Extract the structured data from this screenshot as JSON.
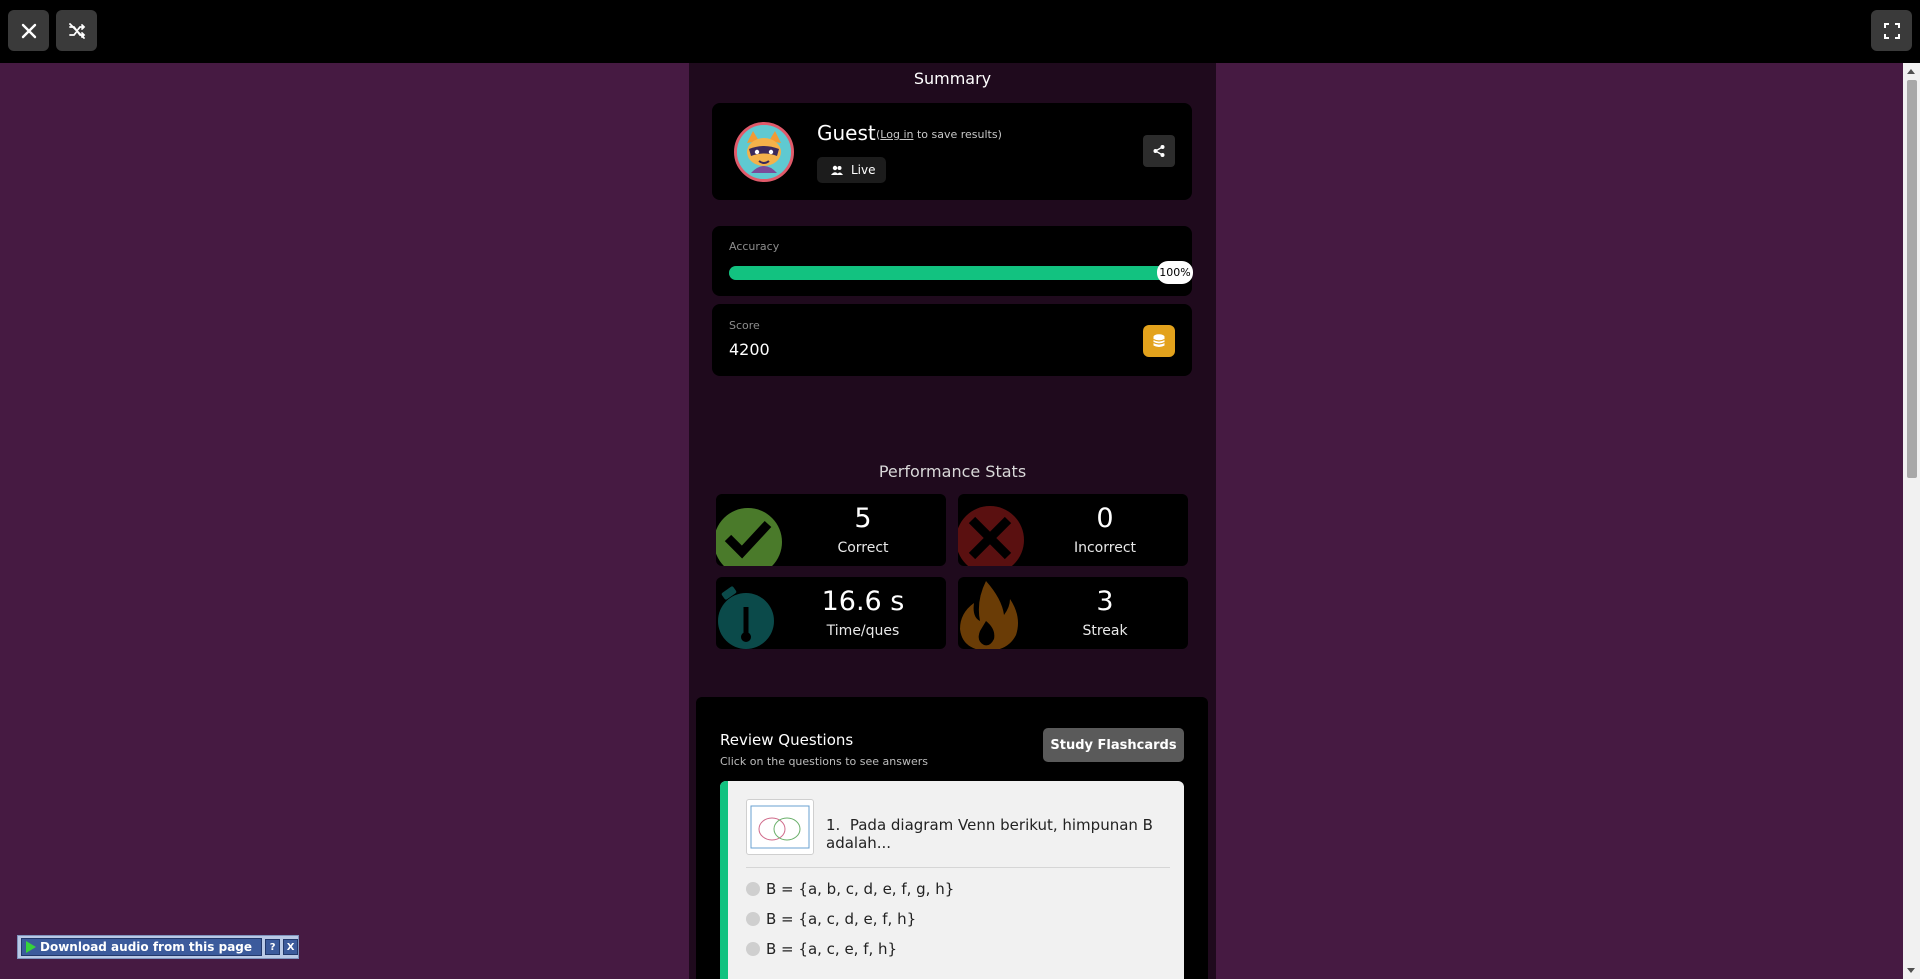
{
  "topbar": {
    "close_icon": "close-icon",
    "shuffle_off_icon": "shuffle-off-icon",
    "fullscreen_icon": "fullscreen-icon"
  },
  "summary": {
    "title": "Summary",
    "player_name": "Guest",
    "login_prefix": "(",
    "login_link": "Log in",
    "login_suffix": " to save results)",
    "mode": "Live"
  },
  "accuracy": {
    "label": "Accuracy",
    "value_text": "100%",
    "fraction": 1.0,
    "color": "#12c280"
  },
  "score": {
    "label": "Score",
    "value": "4200"
  },
  "performance": {
    "title": "Performance Stats",
    "stats": [
      {
        "value": "5",
        "label": "Correct",
        "icon": "check-icon",
        "color": "#4a7a2a"
      },
      {
        "value": "0",
        "label": "Incorrect",
        "icon": "cross-icon",
        "color": "#5a1010"
      },
      {
        "value": "16.6 s",
        "label": "Time/ques",
        "icon": "stopwatch-icon",
        "color": "#0b4a4a"
      },
      {
        "value": "3",
        "label": "Streak",
        "icon": "flame-icon",
        "color": "#6a3c06"
      }
    ]
  },
  "review": {
    "title": "Review Questions",
    "subtitle": "Click on the questions to see answers",
    "flashcards_button": "Study Flashcards",
    "question": {
      "number": "1.",
      "text": "Pada diagram Venn berikut, himpunan B adalah...",
      "options": [
        "B = {a, b, c, d, e, f, g, h}",
        "B = {a, c, d, e, f, h}",
        "B = {a, c, e, f, h}"
      ]
    }
  },
  "download_bar": {
    "label": "Download audio from this page",
    "help": "?",
    "close": "X"
  }
}
